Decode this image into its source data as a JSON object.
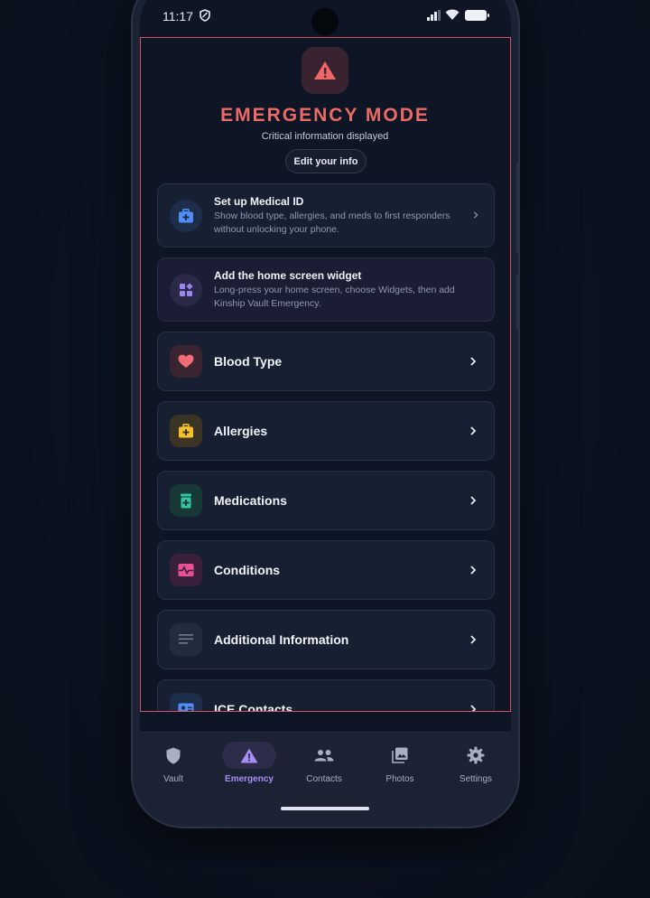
{
  "status_bar": {
    "time": "11:17"
  },
  "hero": {
    "title": "EMERGENCY MODE",
    "subtitle": "Critical information displayed",
    "edit_label": "Edit your info"
  },
  "setup_cards": [
    {
      "title": "Set up Medical ID",
      "description": "Show blood type, allergies, and meds to first responders without unlocking your phone.",
      "icon": "medical-bag-icon"
    },
    {
      "title": "Add the home screen widget",
      "description": "Long-press your home screen, choose Widgets, then add Kinship Vault Emergency.",
      "icon": "widgets-icon"
    }
  ],
  "sections": [
    {
      "label": "Blood Type",
      "icon": "heart-icon",
      "accent": "#f16c74"
    },
    {
      "label": "Allergies",
      "icon": "medical-bag-icon",
      "accent": "#f5c02a"
    },
    {
      "label": "Medications",
      "icon": "medication-icon",
      "accent": "#2fc7a4"
    },
    {
      "label": "Conditions",
      "icon": "pulse-icon",
      "accent": "#ea4f95"
    },
    {
      "label": "Additional Information",
      "icon": "notes-icon",
      "accent": "#6f7b8f"
    },
    {
      "label": "ICE Contacts",
      "icon": "contact-card-icon",
      "accent": "#4f8ef5"
    }
  ],
  "nav": {
    "items": [
      {
        "label": "Vault",
        "icon": "shield-icon"
      },
      {
        "label": "Emergency",
        "icon": "warning-icon",
        "active": true
      },
      {
        "label": "Contacts",
        "icon": "people-icon"
      },
      {
        "label": "Photos",
        "icon": "photos-icon"
      },
      {
        "label": "Settings",
        "icon": "gear-icon"
      }
    ]
  },
  "colors": {
    "accent_red": "#ec6a66",
    "active_nav": "#a88cf6",
    "background": "#0e1626",
    "card": "#172033"
  }
}
